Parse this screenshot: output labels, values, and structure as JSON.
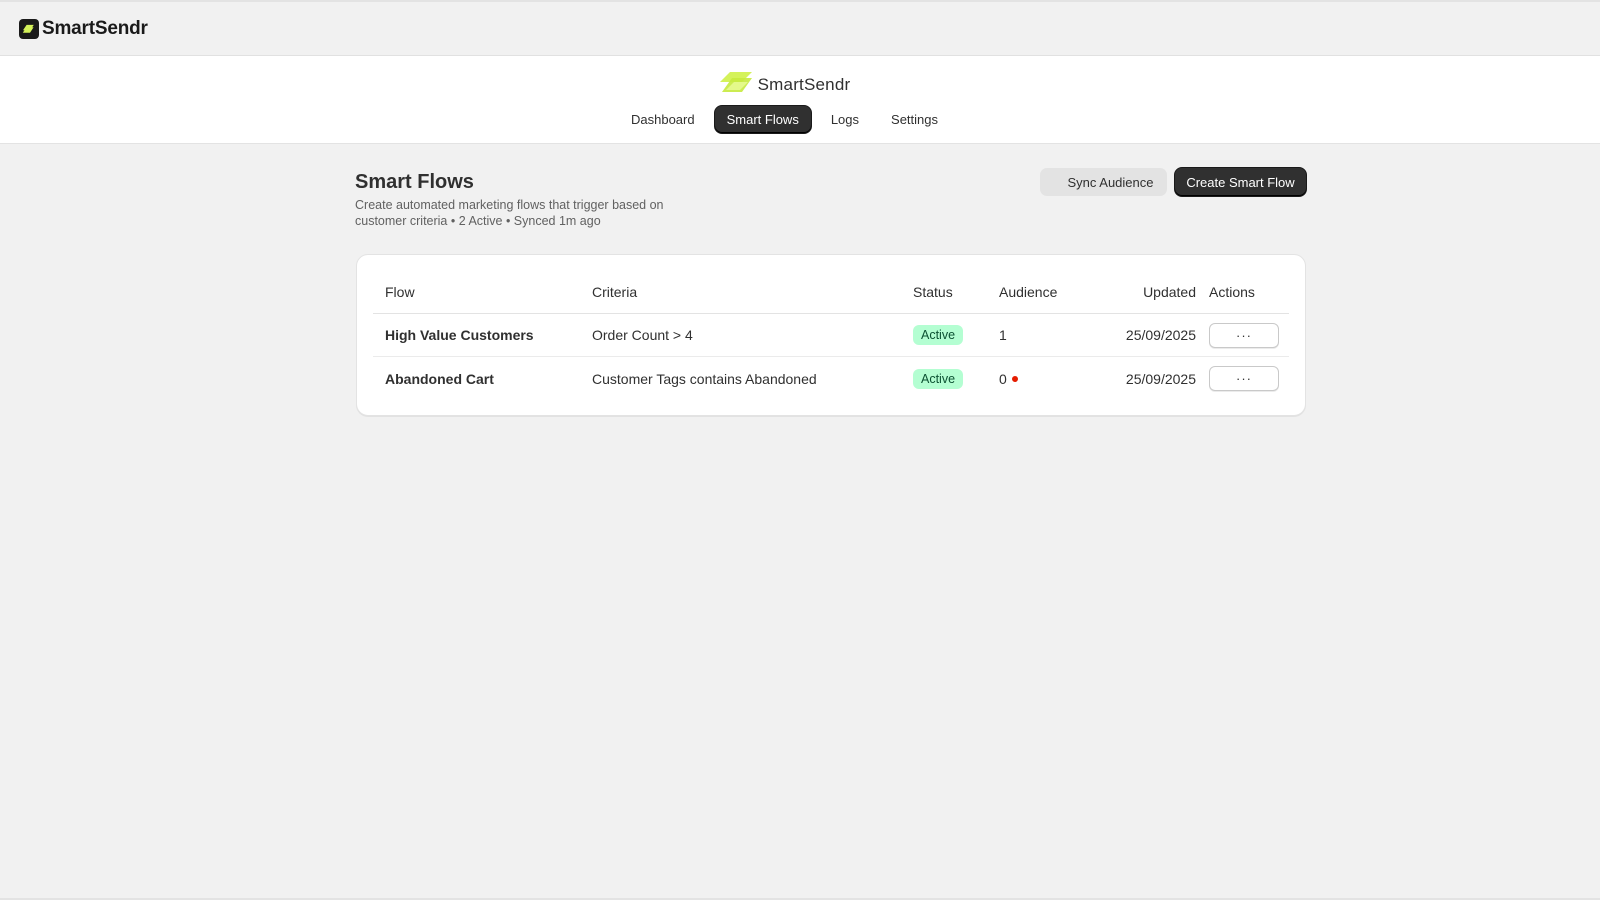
{
  "app": {
    "name": "SmartSendr",
    "brand_text": "SmartSendr"
  },
  "nav": {
    "items": [
      {
        "label": "Dashboard",
        "active": false
      },
      {
        "label": "Smart Flows",
        "active": true
      },
      {
        "label": "Logs",
        "active": false
      },
      {
        "label": "Settings",
        "active": false
      }
    ]
  },
  "page": {
    "title": "Smart Flows",
    "subtitle": "Create automated marketing flows that trigger based on customer criteria • 2 Active • Synced 1m ago",
    "sync_button": "Sync Audience",
    "create_button": "Create Smart Flow"
  },
  "table": {
    "headers": {
      "flow": "Flow",
      "criteria": "Criteria",
      "status": "Status",
      "audience": "Audience",
      "updated": "Updated",
      "actions": "Actions"
    },
    "rows": [
      {
        "flow": "High Value Customers",
        "criteria": "Order Count > 4",
        "status": "Active",
        "audience": "1",
        "audience_alert": false,
        "updated": "25/09/2025",
        "actions": "···"
      },
      {
        "flow": "Abandoned Cart",
        "criteria": "Customer Tags contains Abandoned",
        "status": "Active",
        "audience": "0",
        "audience_alert": true,
        "updated": "25/09/2025",
        "actions": "···"
      }
    ]
  },
  "colors": {
    "primary_button": "#303030",
    "active_badge_bg": "#b4fed2",
    "active_badge_text": "#0c5132",
    "alert_dot": "#e51c00",
    "brand_accent": "#d4f25a"
  },
  "icons": {
    "app_logo": "smartsendr-logo-icon",
    "brand_logo": "smartsendr-brand-icon"
  }
}
